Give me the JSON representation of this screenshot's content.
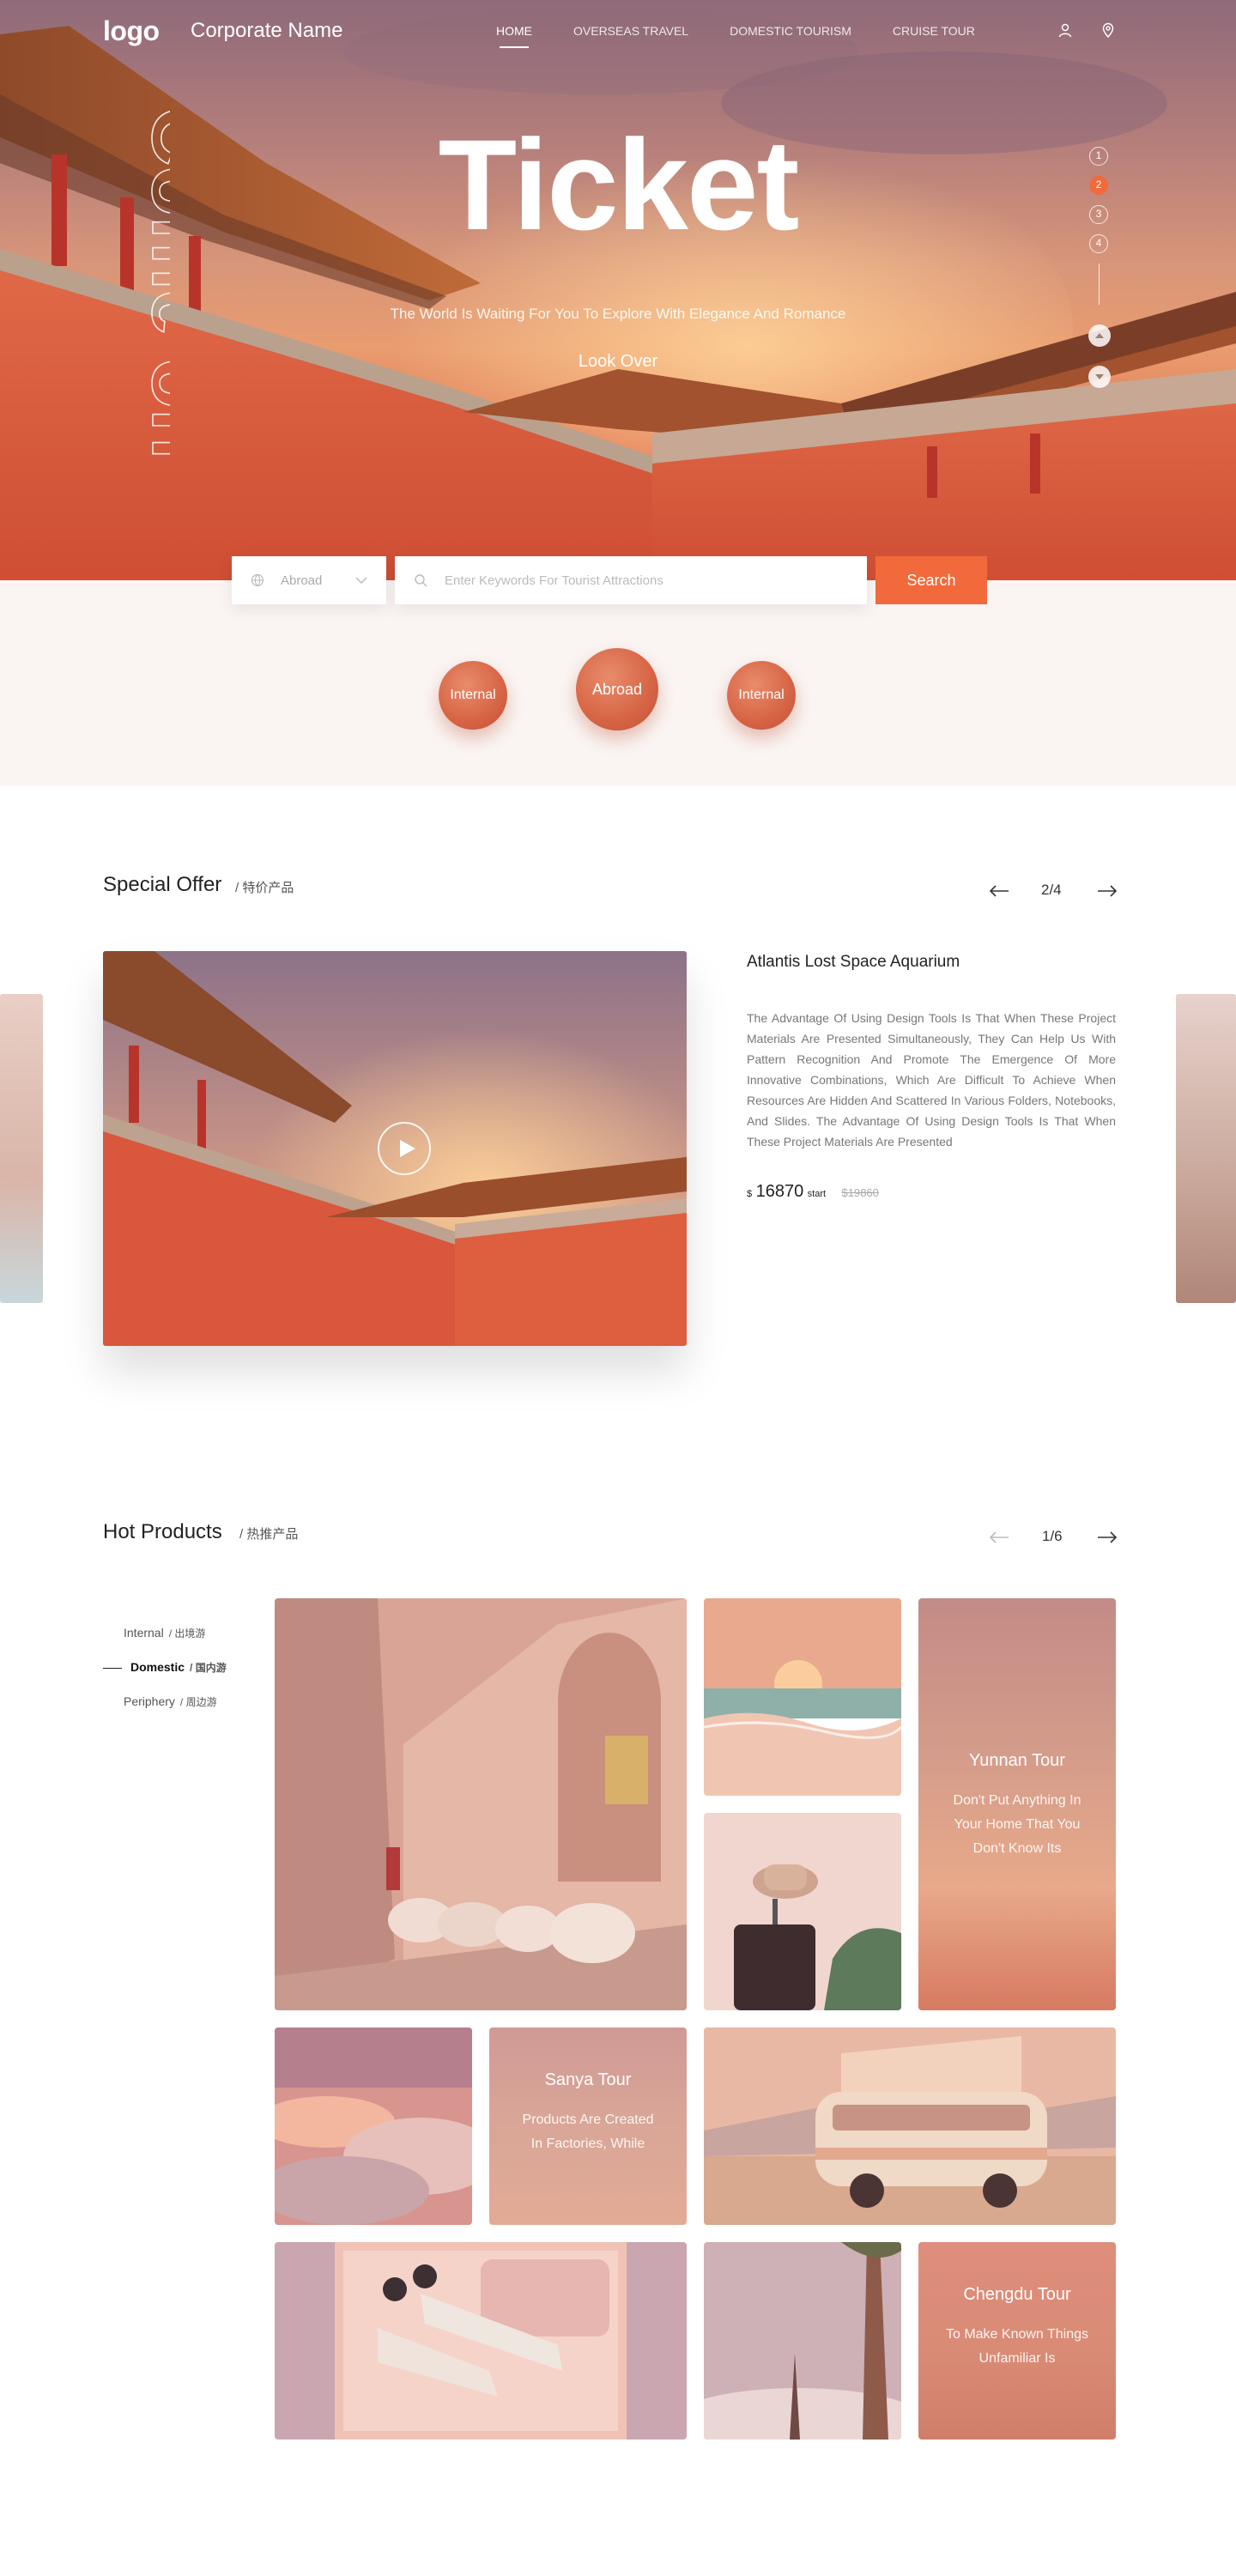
{
  "header": {
    "logo": "logo",
    "corp_name": "Corporate Name",
    "nav": [
      "HOME",
      "OVERSEAS TRAVEL",
      "DOMESTIC TOURISM",
      "CRUISE TOUR"
    ],
    "icons": [
      "user-icon",
      "location-icon"
    ]
  },
  "hero": {
    "side_word": "Come on",
    "title": "Ticket",
    "subtitle": "The World Is Waiting For You To Explore With Elegance And Romance",
    "look_over": "Look Over",
    "pager_dots": [
      "1",
      "2",
      "3",
      "4"
    ],
    "active_dot": 2
  },
  "search": {
    "region_value": "Abroad",
    "keyword_placeholder": "Enter Keywords For Tourist Attractions",
    "button": "Search"
  },
  "categories": [
    "Internal",
    "Abroad",
    "Internal"
  ],
  "special_offer": {
    "title": "Special Offer",
    "subtitle": "/ 特价产品",
    "pager": "2/4",
    "name": "Atlantis Lost Space Aquarium",
    "description": "The Advantage Of Using Design Tools Is That When These Project Materials Are Presented Simultaneously, They Can Help Us With Pattern Recognition And Promote The Emergence Of More Innovative Combinations, Which Are Difficult To Achieve When Resources Are Hidden And Scattered In Various Folders, Notebooks, And Slides. The Advantage Of Using Design Tools Is That When These Project Materials Are Presented",
    "currency": "$",
    "price": "16870",
    "price_suffix": "start",
    "old_price": "$19860"
  },
  "hot_products": {
    "title": "Hot Products",
    "subtitle": "/ 热推产品",
    "pager": "1/6",
    "filters": [
      {
        "label": "Internal",
        "zh": "/ 出境游"
      },
      {
        "label": "Domestic",
        "zh": "/ 国内游"
      },
      {
        "label": "Periphery",
        "zh": "/ 周边游"
      }
    ],
    "active_filter": 1,
    "tiles": {
      "yunnan": {
        "title": "Yunnan Tour",
        "text": "Don't Put Anything In Your Home That You Don't Know Its"
      },
      "sanya": {
        "title": "Sanya Tour",
        "text": "Products Are Created In Factories, While"
      },
      "chengdu": {
        "title": "Chengdu Tour",
        "text": "To Make Known Things Unfamiliar Is"
      }
    }
  },
  "colors": {
    "accent": "#f26a3c",
    "band": "#faf5f3",
    "text_dark": "#222222",
    "text_muted": "#777777"
  }
}
